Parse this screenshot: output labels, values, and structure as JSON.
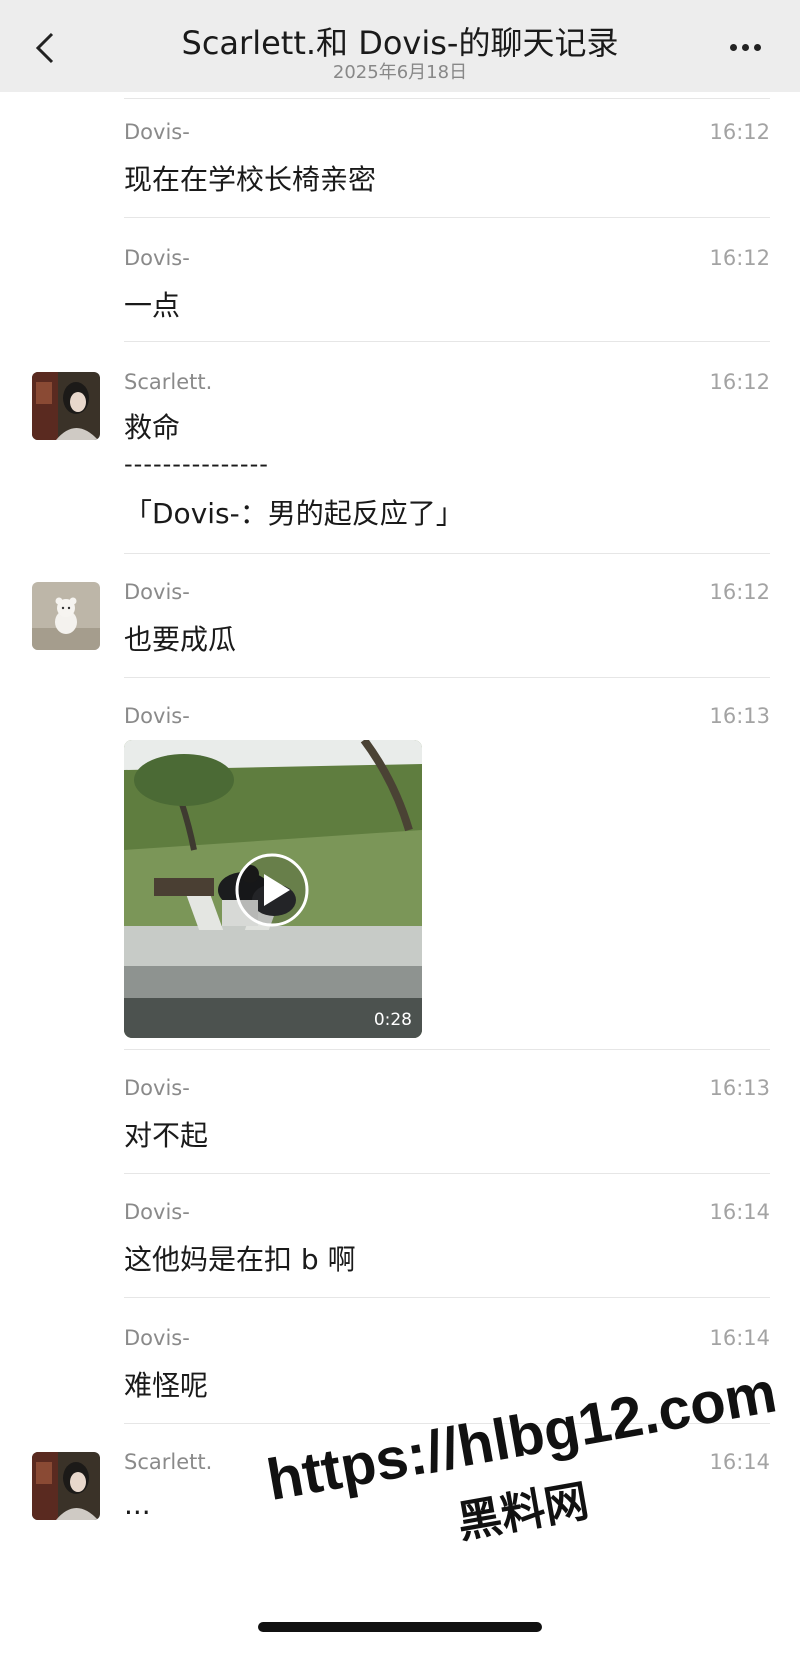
{
  "header": {
    "title": "Scarlett.和 Dovis-的聊天记录",
    "date": "2025年6月18日"
  },
  "messages": [
    {
      "sender": "Dovis-",
      "time": "16:12",
      "text": "现在在学校长椅亲密"
    },
    {
      "sender": "Dovis-",
      "time": "16:12",
      "text": "一点"
    },
    {
      "sender": "Scarlett.",
      "time": "16:12",
      "text": "救命",
      "divider": "---------------",
      "quote": "「Dovis-：男的起反应了」"
    },
    {
      "sender": "Dovis-",
      "time": "16:12",
      "text": "也要成瓜"
    },
    {
      "sender": "Dovis-",
      "time": "16:13",
      "video_duration": "0:28"
    },
    {
      "sender": "Dovis-",
      "time": "16:13",
      "text": "对不起"
    },
    {
      "sender": "Dovis-",
      "time": "16:14",
      "text": "这他妈是在扣 b 啊"
    },
    {
      "sender": "Dovis-",
      "time": "16:14",
      "text": "难怪呢"
    },
    {
      "sender": "Scarlett.",
      "time": "16:14",
      "text": "..."
    }
  ],
  "watermark": {
    "line1": "https://hlbg12.com",
    "line2": "黑料网"
  },
  "icons": {
    "back": "chevron-left-icon",
    "more": "more-dots-icon",
    "play": "play-icon"
  }
}
